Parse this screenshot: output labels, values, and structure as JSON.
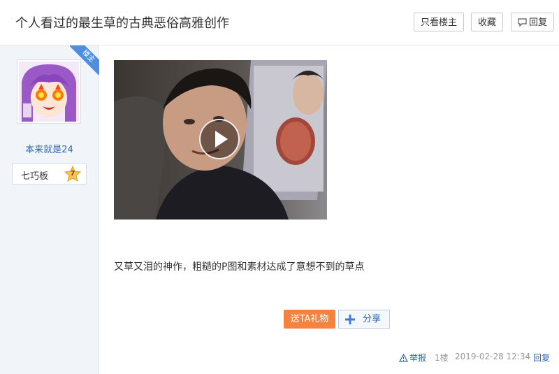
{
  "thread": {
    "title": "个人看过的最生草的古典恶俗高雅创作",
    "buttons": {
      "only_owner": "只看楼主",
      "favorite": "收藏",
      "reply": "回复"
    }
  },
  "author": {
    "owner_tag": "楼主",
    "username": "本来就是24",
    "level_name": "七巧板",
    "level": "7"
  },
  "post": {
    "content": "又草又泪的神作，粗糙的P图和素材达成了意想不到的草点",
    "gift_button": "送TA礼物",
    "share_button": "分享",
    "report": "举报",
    "floor": "1楼",
    "timestamp": "2019-02-28 12:34",
    "reply": "回复"
  },
  "colors": {
    "link": "#2d64b3",
    "gift": "#f5823d",
    "owner_tag": "#4e8ee0"
  }
}
